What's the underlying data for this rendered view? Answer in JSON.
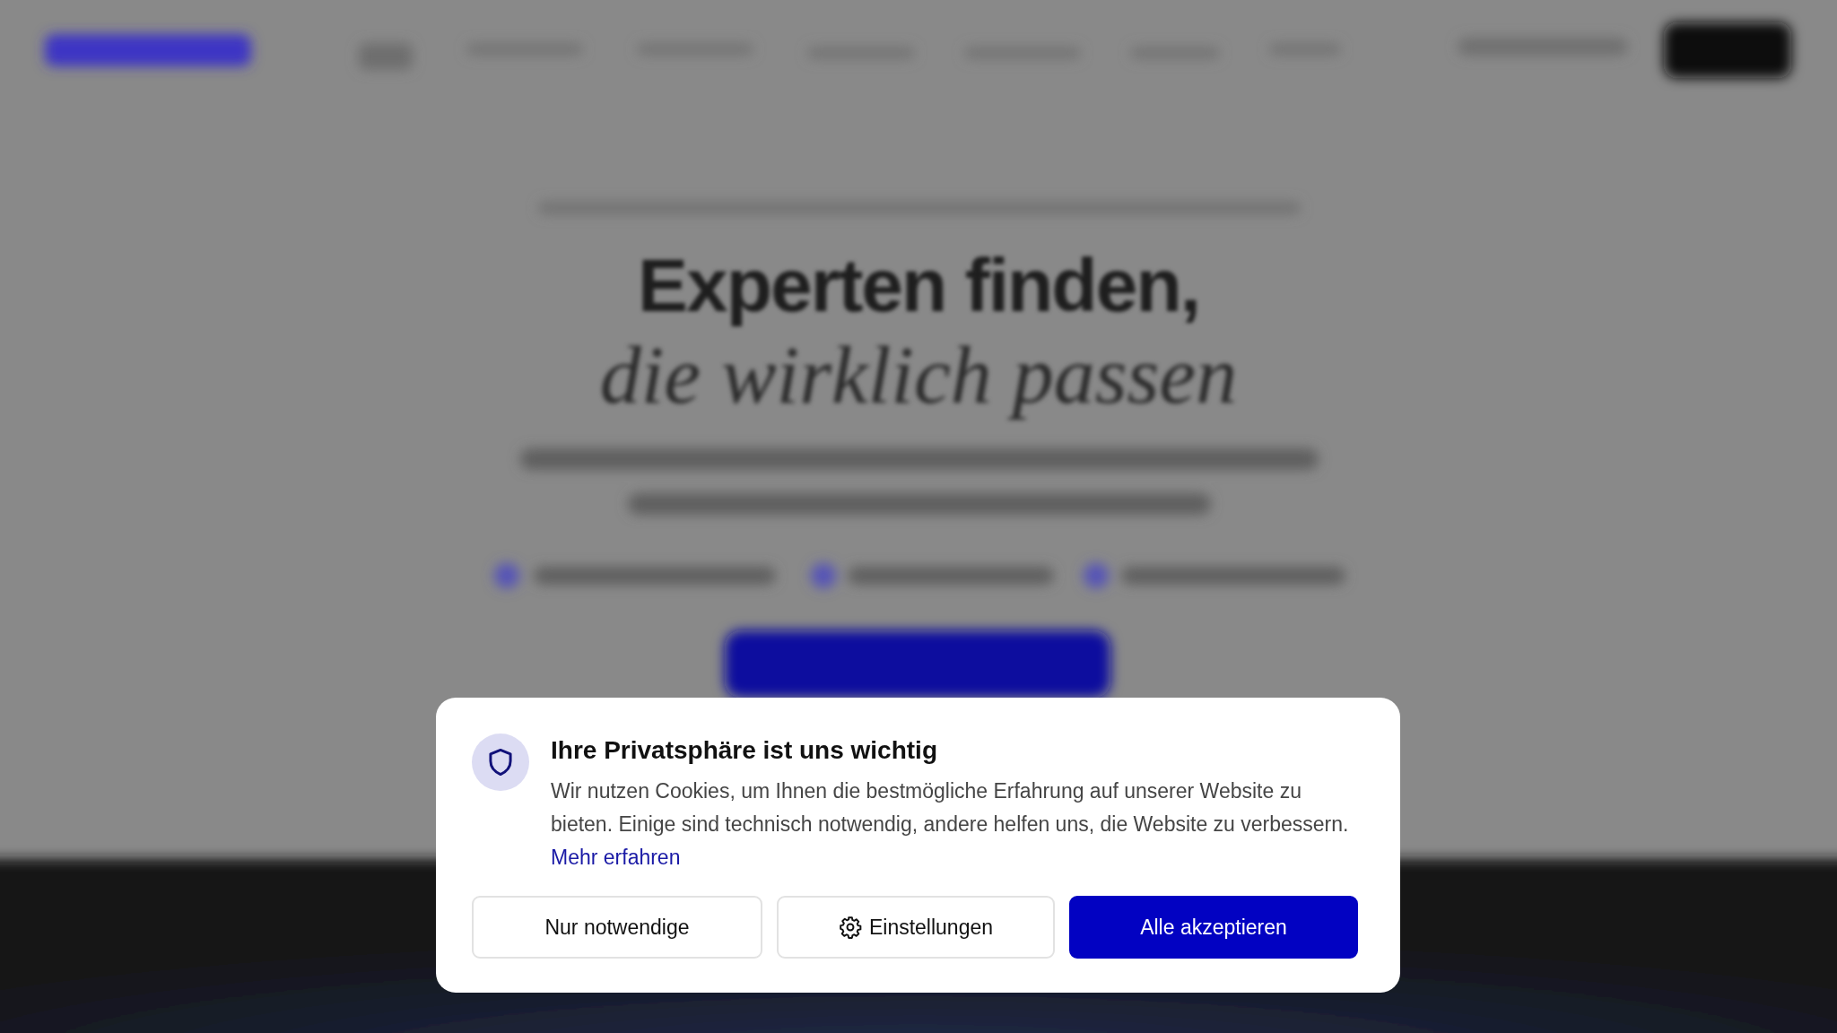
{
  "background": {
    "headline": "Experten finden,",
    "headline_italic": "die wirklich passen"
  },
  "dialog": {
    "title": "Ihre Privatsphäre ist uns wichtig",
    "text": "Wir nutzen Cookies, um Ihnen die bestmögliche Erfahrung auf unserer Website zu bieten. Einige sind technisch notwendig, andere helfen uns, die Website zu verbessern.",
    "link": "Mehr erfahren",
    "buttons": [
      {
        "label": "Nur notwendige",
        "kind": "outline"
      },
      {
        "label": "Einstellungen",
        "kind": "settings"
      },
      {
        "label": "Alle akzeptieren",
        "kind": "primary"
      }
    ]
  }
}
